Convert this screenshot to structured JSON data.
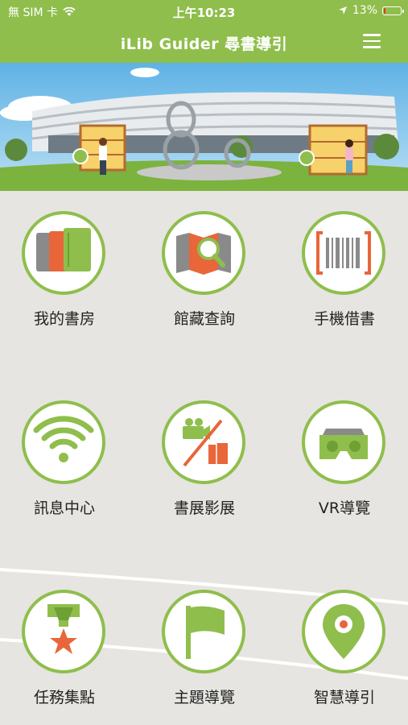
{
  "status_bar": {
    "carrier": "無 SIM 卡",
    "time": "上午10:23",
    "battery": "13%",
    "battery_level": 0.13,
    "battery_color": "#e5322d"
  },
  "nav": {
    "title": "iLib Guider 尋書導引",
    "menu_icon": "hamburger-menu-icon"
  },
  "colors": {
    "brand_green": "#8fbe4c",
    "icon_orange": "#e8663a",
    "background": "#e6e5e1"
  },
  "menu_items": [
    {
      "label": "我的書房",
      "icon": "books-icon"
    },
    {
      "label": "館藏查詢",
      "icon": "book-search-icon"
    },
    {
      "label": "手機借書",
      "icon": "barcode-icon"
    },
    {
      "label": "訊息中心",
      "icon": "wifi-icon"
    },
    {
      "label": "書展影展",
      "icon": "camera-books-icon"
    },
    {
      "label": "VR導覽",
      "icon": "vr-headset-icon"
    },
    {
      "label": "任務集點",
      "icon": "medal-icon"
    },
    {
      "label": "主題導覽",
      "icon": "flag-icon"
    },
    {
      "label": "智慧導引",
      "icon": "location-pin-icon"
    }
  ]
}
